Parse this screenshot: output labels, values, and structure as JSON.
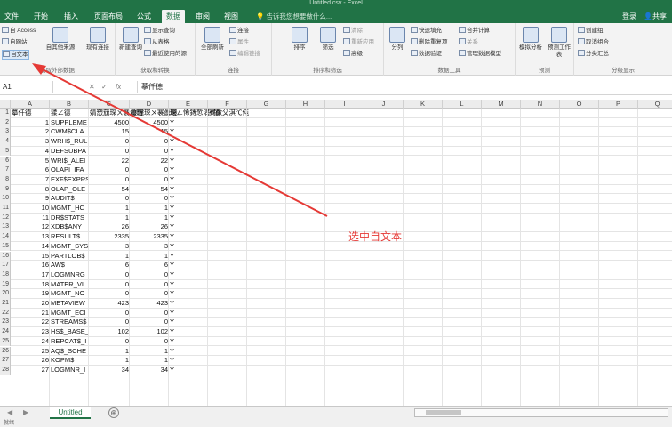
{
  "title": "Untitled.csv - Excel",
  "tabs": [
    "文件",
    "开始",
    "插入",
    "页面布局",
    "公式",
    "数据",
    "审阅",
    "视图"
  ],
  "search_placeholder": "告诉我您想要做什么...",
  "login": "登录",
  "share": "共享",
  "ribbon": {
    "get_external": {
      "label": "获取外部数据",
      "items": [
        "自 Access",
        "自网站",
        "自文本"
      ],
      "other": "自其他来源",
      "existing": "现有连接"
    },
    "get_transform": {
      "label": "获取和转换",
      "new_query": "新建查询",
      "items": [
        "显示查询",
        "从表格",
        "最近使用的源"
      ]
    },
    "connections": {
      "label": "连接",
      "refresh": "全部刷新",
      "items": [
        "连接",
        "属性",
        "编辑链接"
      ]
    },
    "sort_filter": {
      "label": "排序和筛选",
      "sort": "排序",
      "filter": "筛选",
      "items": [
        "清除",
        "重新应用",
        "高级"
      ]
    },
    "data_tools": {
      "label": "数据工具",
      "split": "分列",
      "items": [
        "快速填充",
        "删除重复项",
        "数据验证",
        "合并计算",
        "关系",
        "管理数据模型"
      ]
    },
    "forecast": {
      "label": "预测",
      "items": [
        "模拟分析",
        "预测工作表"
      ]
    },
    "outline": {
      "label": "分级显示",
      "items": [
        "创建组",
        "取消组合",
        "分类汇总"
      ]
    }
  },
  "namebox": "A1",
  "formula_value": "摹仟德",
  "columns": [
    "A",
    "B",
    "C",
    "D",
    "E",
    "F",
    "G",
    "H",
    "I",
    "J",
    "K",
    "L",
    "M",
    "N",
    "O",
    "P",
    "Q"
  ],
  "rows": [
    [
      "1",
      "摹仟德",
      "猱∠德",
      "婧愬簱琛ㄨ褰曟暟",
      "鐩爣琛ㄨ褰曟暟",
      "琛ㄥ悕鏄惁涓€鑷",
      "寮傚父淇℃伅"
    ],
    [
      "2",
      "1",
      "SUPPLEME",
      "4500",
      "4500",
      "Y"
    ],
    [
      "3",
      "2",
      "CWM$CLA",
      "15",
      "15",
      "Y"
    ],
    [
      "4",
      "3",
      "WRH$_RUL",
      "0",
      "0",
      "Y"
    ],
    [
      "5",
      "4",
      "DEFSUBPA",
      "0",
      "0",
      "Y"
    ],
    [
      "6",
      "5",
      "WRI$_ALEI",
      "22",
      "22",
      "Y"
    ],
    [
      "7",
      "6",
      "OLAPI_IFA",
      "0",
      "0",
      "Y"
    ],
    [
      "8",
      "7",
      "EXF$EXPRS",
      "0",
      "0",
      "Y"
    ],
    [
      "9",
      "8",
      "OLAP_OLE",
      "54",
      "54",
      "Y"
    ],
    [
      "10",
      "9",
      "AUDIT$",
      "0",
      "0",
      "Y"
    ],
    [
      "11",
      "10",
      "MGMT_HC",
      "1",
      "1",
      "Y"
    ],
    [
      "12",
      "11",
      "DR$STATS",
      "1",
      "1",
      "Y"
    ],
    [
      "13",
      "12",
      "XDB$ANY",
      "26",
      "26",
      "Y"
    ],
    [
      "14",
      "13",
      "RESULT$",
      "2335",
      "2335",
      "Y"
    ],
    [
      "15",
      "14",
      "MGMT_SYS",
      "3",
      "3",
      "Y"
    ],
    [
      "16",
      "15",
      "PARTLOB$",
      "1",
      "1",
      "Y"
    ],
    [
      "17",
      "16",
      "AW$",
      "6",
      "6",
      "Y"
    ],
    [
      "18",
      "17",
      "LOGMNRG",
      "0",
      "0",
      "Y"
    ],
    [
      "19",
      "18",
      "MATER_VI",
      "0",
      "0",
      "Y"
    ],
    [
      "20",
      "19",
      "MGMT_NO",
      "0",
      "0",
      "Y"
    ],
    [
      "21",
      "20",
      "METAVIEW",
      "423",
      "423",
      "Y"
    ],
    [
      "22",
      "21",
      "MGMT_ECI",
      "0",
      "0",
      "Y"
    ],
    [
      "23",
      "22",
      "STREAMS$",
      "0",
      "0",
      "Y"
    ],
    [
      "24",
      "23",
      "HS$_BASE_",
      "102",
      "102",
      "Y"
    ],
    [
      "25",
      "24",
      "REPCAT$_I",
      "0",
      "0",
      "Y"
    ],
    [
      "26",
      "25",
      "AQ$_SCHE",
      "1",
      "1",
      "Y"
    ],
    [
      "27",
      "26",
      "KOPM$",
      "1",
      "1",
      "Y"
    ],
    [
      "28",
      "27",
      "LOGMNR_I",
      "34",
      "34",
      "Y"
    ]
  ],
  "annotation": "选中自文本",
  "sheet_tab": "Untitled",
  "add_sheet": "⊕",
  "status": "就绪"
}
